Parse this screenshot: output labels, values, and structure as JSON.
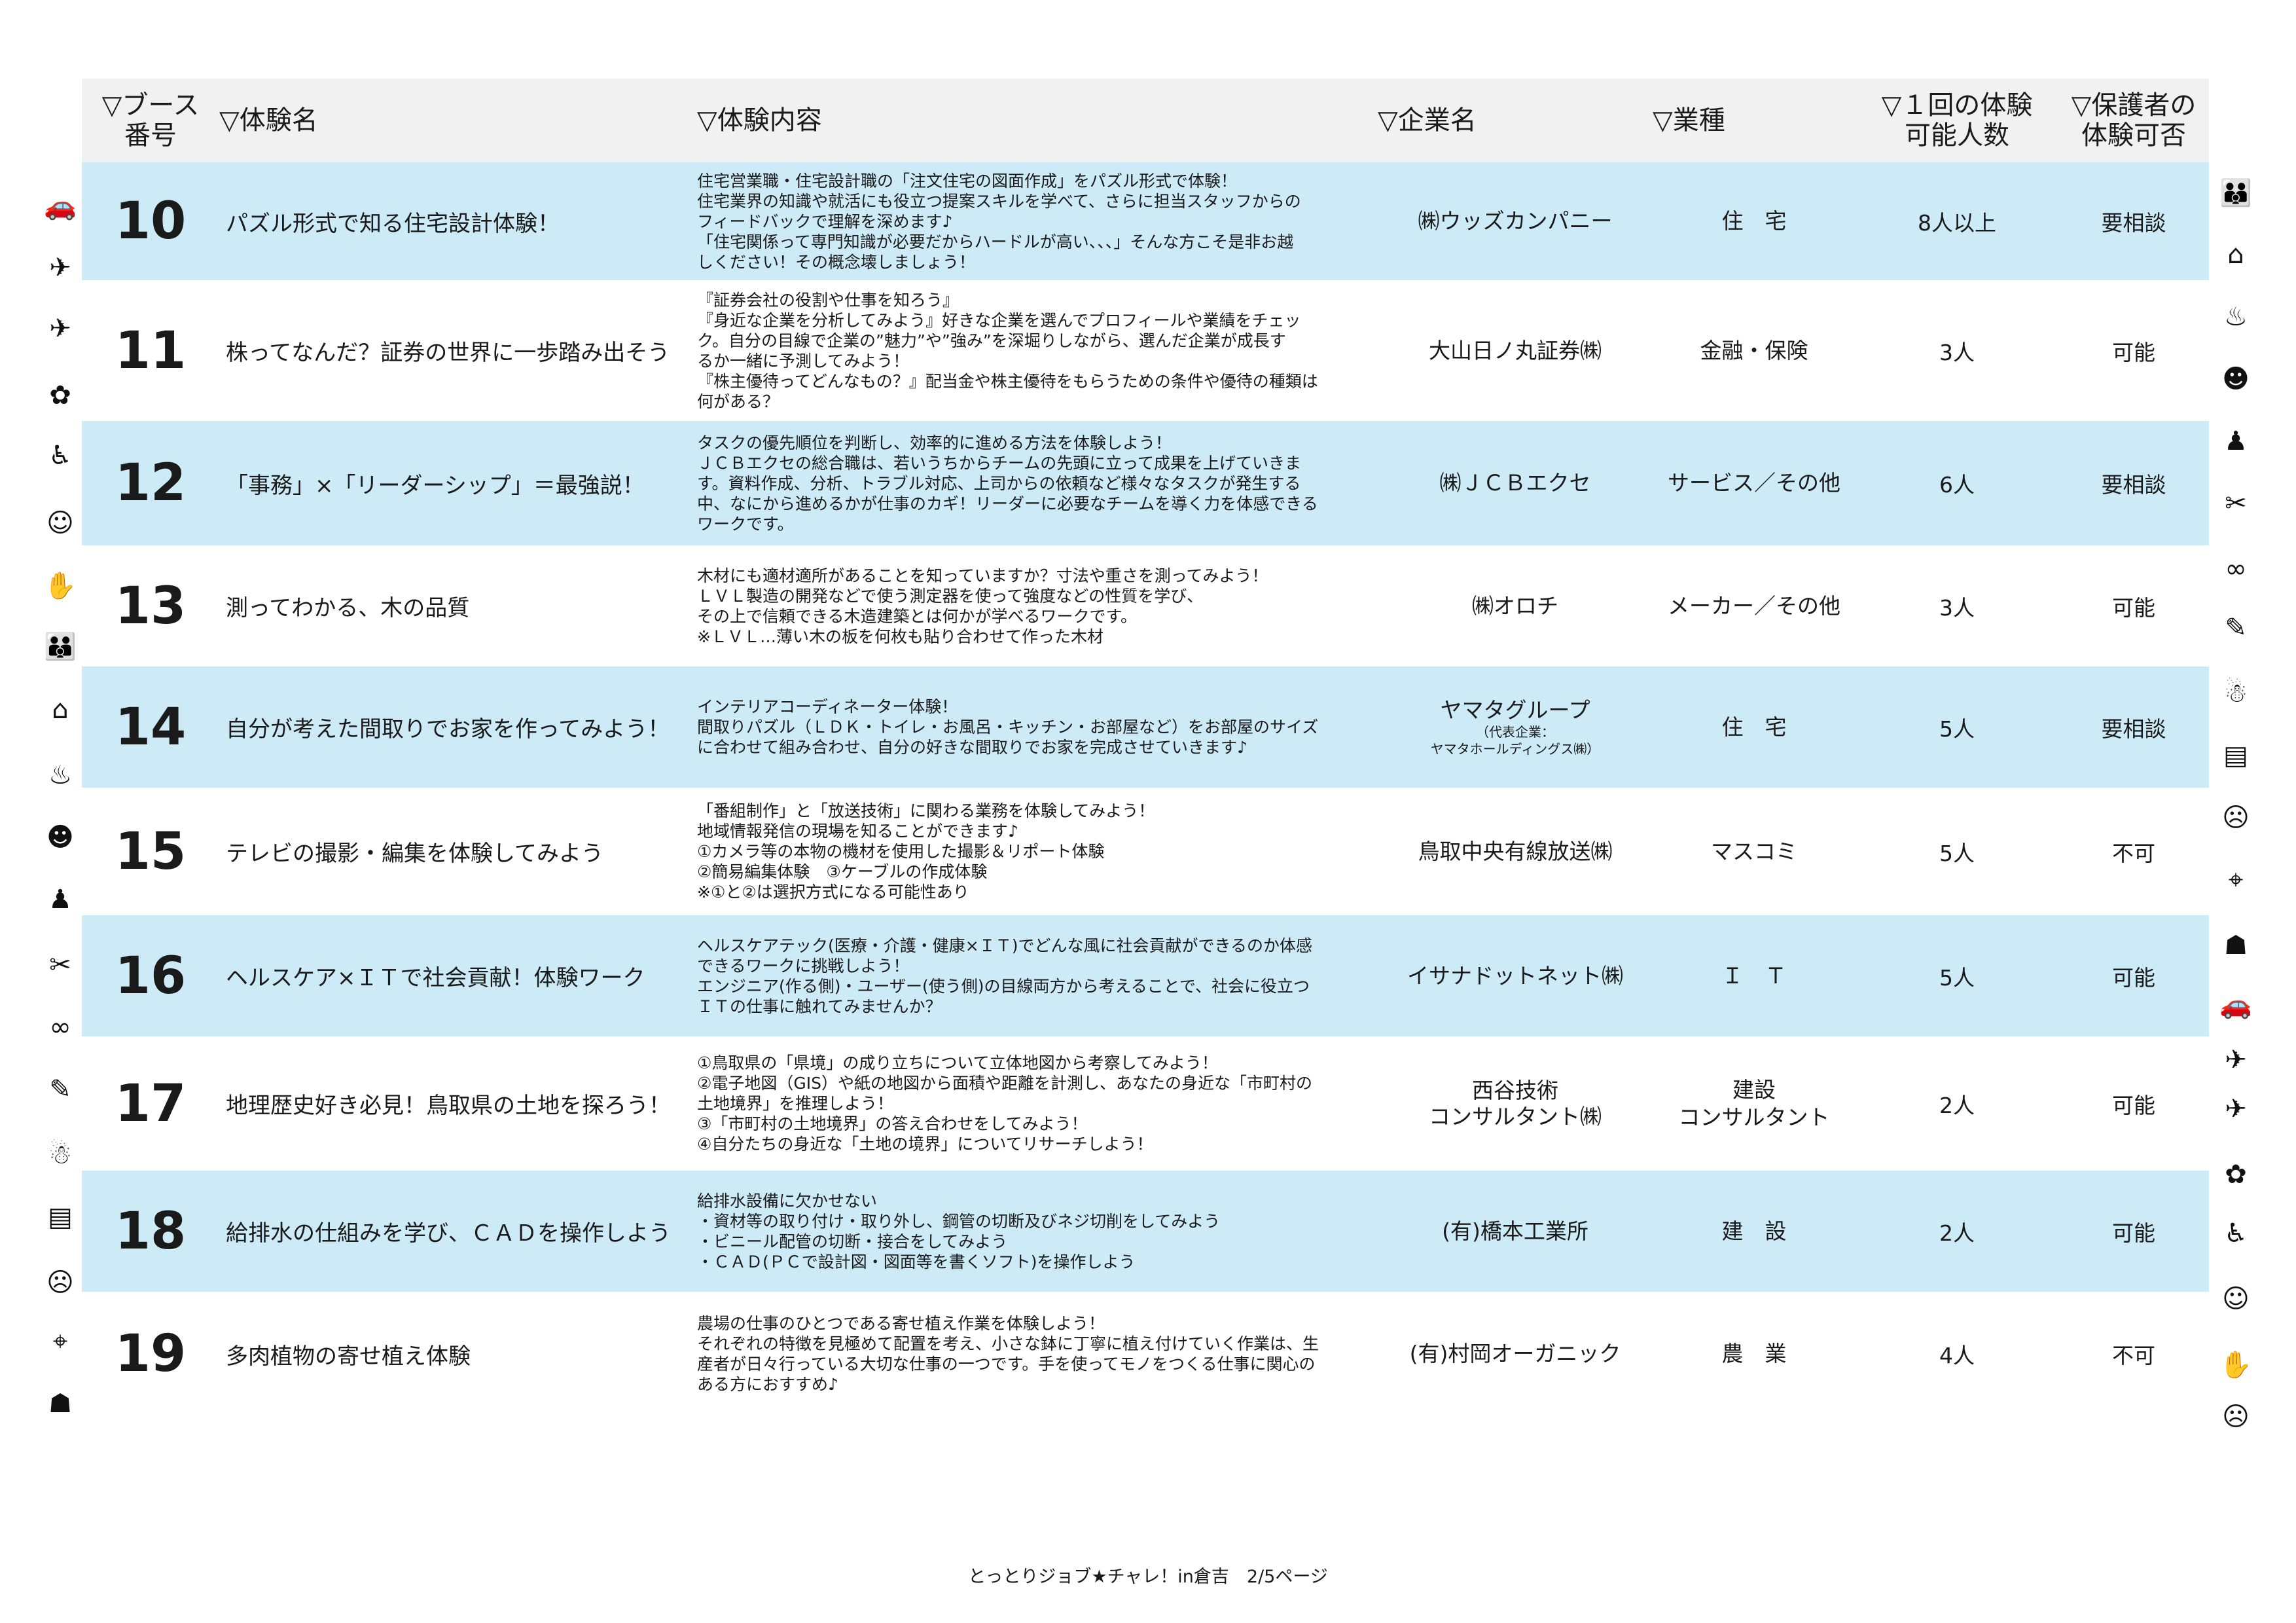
{
  "header": {
    "booth": "▽ブース\n番号",
    "name": "▽体験名",
    "content": "▽体験内容",
    "company": "▽企業名",
    "industry": "▽業種",
    "capacity": "▽１回の体験\n可能人数",
    "guardian": "▽保護者の\n体験可否"
  },
  "rows": [
    {
      "num": "10",
      "name": "パズル形式で知る住宅設計体験！",
      "content": "住宅営業職・住宅設計職の「注文住宅の図面作成」をパズル形式で体験！\n住宅業界の知識や就活にも役立つ提案スキルを学べて、さらに担当スタッフからの\nフィードバックで理解を深めます♪\n「住宅関係って専門知識が必要だからハードルが高い、、、」そんな方こそ是非お越\nしください！その概念壊しましょう！",
      "company": "㈱ウッズカンパニー",
      "company_sub": "",
      "industry": "住　宅",
      "capacity": "8人以上",
      "guardian": "要相談"
    },
    {
      "num": "11",
      "name": "株ってなんだ？証券の世界に一歩踏み出そう",
      "content": "『証券会社の役割や仕事を知ろう』\n『身近な企業を分析してみよう』好きな企業を選んでプロフィールや業績をチェッ\nク。自分の目線で企業の”魅力”や”強み”を深堀りしながら、選んだ企業が成長す\nるか一緒に予測してみよう！\n『株主優待ってどんなもの？』配当金や株主優待をもらうための条件や優待の種類は\n何がある？",
      "company": "大山日ノ丸証券㈱",
      "company_sub": "",
      "industry": "金融・保険",
      "capacity": "3人",
      "guardian": "可能"
    },
    {
      "num": "12",
      "name": "「事務」×「リーダーシップ」＝最強説！",
      "content": "タスクの優先順位を判断し、効率的に進める方法を体験しよう！\nＪＣＢエクセの総合職は、若いうちからチームの先頭に立って成果を上げていきま\nす。資料作成、分析、トラブル対応、上司からの依頼など様々なタスクが発生する\n中、なにから進めるかが仕事のカギ！リーダーに必要なチームを導く力を体感できる\nワークです。",
      "company": "㈱ＪＣＢエクセ",
      "company_sub": "",
      "industry": "サービス／その他",
      "capacity": "6人",
      "guardian": "要相談"
    },
    {
      "num": "13",
      "name": "測ってわかる、木の品質",
      "content": "木材にも適材適所があることを知っていますか？寸法や重さを測ってみよう！\nＬＶＬ製造の開発などで使う測定器を使って強度などの性質を学び、\nその上で信頼できる木造建築とは何かが学べるワークです。\n※ＬＶＬ…薄い木の板を何枚も貼り合わせて作った木材",
      "company": "㈱オロチ",
      "company_sub": "",
      "industry": "メーカー／その他",
      "capacity": "3人",
      "guardian": "可能"
    },
    {
      "num": "14",
      "name": "自分が考えた間取りでお家を作ってみよう！",
      "content": "インテリアコーディネーター体験！\n間取りパズル（ＬＤＫ・トイレ・お風呂・キッチン・お部屋など）をお部屋のサイズ\nに合わせて組み合わせ、自分の好きな間取りでお家を完成させていきます♪",
      "company": "ヤマタグループ",
      "company_sub": "（代表企業：\nヤマタホールディングス㈱）",
      "industry": "住　宅",
      "capacity": "5人",
      "guardian": "要相談"
    },
    {
      "num": "15",
      "name": "テレビの撮影・編集を体験してみよう",
      "content": "「番組制作」と「放送技術」に関わる業務を体験してみよう！\n地域情報発信の現場を知ることができます♪\n①カメラ等の本物の機材を使用した撮影＆リポート体験\n②簡易編集体験　③ケーブルの作成体験\n※①と②は選択方式になる可能性あり",
      "company": "鳥取中央有線放送㈱",
      "company_sub": "",
      "industry": "マスコミ",
      "capacity": "5人",
      "guardian": "不可"
    },
    {
      "num": "16",
      "name": "ヘルスケア×ＩＴで社会貢献！体験ワーク",
      "content": "ヘルスケアテック(医療・介護・健康×ＩＴ)でどんな風に社会貢献ができるのか体感\nできるワークに挑戦しよう！\nエンジニア(作る側)・ユーザー(使う側)の目線両方から考えることで、社会に役立つ\nＩＴの仕事に触れてみませんか？",
      "company": "イサナドットネット㈱",
      "company_sub": "",
      "industry": "Ｉ　Ｔ",
      "capacity": "5人",
      "guardian": "可能"
    },
    {
      "num": "17",
      "name": "地理歴史好き必見！鳥取県の土地を探ろう！",
      "content": "①鳥取県の「県境」の成り立ちについて立体地図から考察してみよう！\n②電子地図（GIS）や紙の地図から面積や距離を計測し、あなたの身近な「市町村の\n土地境界」を推理しよう！\n③「市町村の土地境界」の答え合わせをしてみよう！\n④自分たちの身近な「土地の境界」についてリサーチしよう！",
      "company": "西谷技術\nコンサルタント㈱",
      "company_sub": "",
      "industry": "建設\nコンサルタント",
      "capacity": "2人",
      "guardian": "可能"
    },
    {
      "num": "18",
      "name": "給排水の仕組みを学び、ＣＡＤを操作しよう",
      "content": "給排水設備に欠かせない\n・資材等の取り付け・取り外し、鋼管の切断及びネジ切削をしてみよう\n・ビニール配管の切断・接合をしてみよう\n・ＣＡＤ(ＰＣで設計図・図面等を書くソフト)を操作しよう",
      "company": "(有)橋本工業所",
      "company_sub": "",
      "industry": "建　設",
      "capacity": "2人",
      "guardian": "可能"
    },
    {
      "num": "19",
      "name": "多肉植物の寄せ植え体験",
      "content": "農場の仕事のひとつである寄せ植え作業を体験しよう！\nそれぞれの特徴を見極めて配置を考え、小さな鉢に丁寧に植え付けていく作業は、生\n産者が日々行っている大切な仕事の一つです。手を使ってモノをつくる仕事に関心の\nある方におすすめ♪",
      "company": "(有)村岡オーガニック",
      "company_sub": "",
      "industry": "農　業",
      "capacity": "4人",
      "guardian": "不可"
    }
  ],
  "footer": "とっとりジョブ★チャレ！in倉吉　2/5ページ",
  "icons_left": [
    "car-icon",
    "drone-icon",
    "drone-icon",
    "tree-icon",
    "wheelchair-icon",
    "doctor-icon",
    "handshake-icon",
    "family-icon",
    "house-icon",
    "cooking-icon",
    "worker-icon",
    "person-icon",
    "repair-icon",
    "network-icon",
    "cleaning-icon",
    "nurse-icon",
    "machine-icon",
    "chef-icon",
    "camera-icon",
    "camera-tripod-icon"
  ],
  "icons_right": [
    "family-icon",
    "house-icon",
    "cooking-icon",
    "worker-icon",
    "person-icon",
    "repair-icon",
    "network-icon",
    "cleaning-icon",
    "nurse-icon",
    "machine-icon",
    "chef-icon",
    "camera-icon",
    "camera-tripod-icon",
    "car-icon",
    "drone-icon",
    "drone-icon",
    "tree-icon",
    "wheelchair-icon",
    "doctor-icon",
    "handshake-icon",
    "chef-icon"
  ],
  "colors": {
    "blue_row": "#cdeaf7",
    "header_bg": "#f1f1f1"
  }
}
